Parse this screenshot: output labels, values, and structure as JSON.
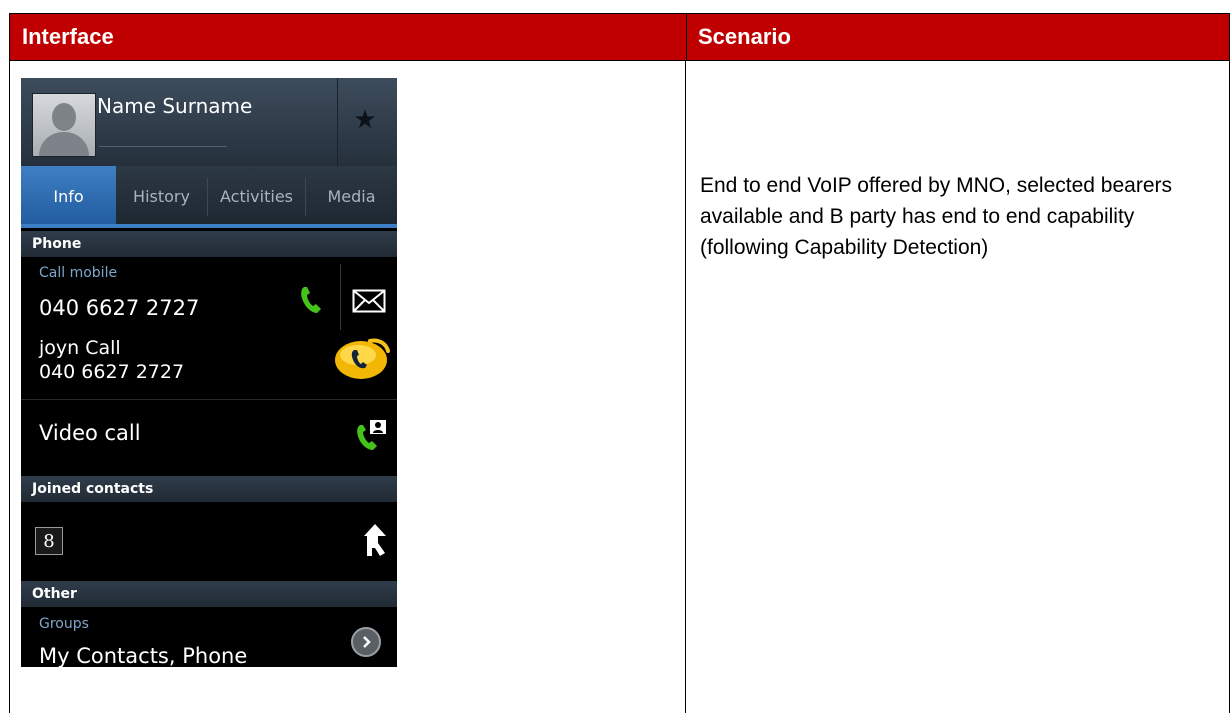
{
  "table": {
    "header_left": "Interface",
    "header_right": "Scenario",
    "scenario_text": "End to end VoIP offered by MNO, selected bearers available and B party has end to end capability (following Capability Detection)"
  },
  "phone": {
    "contact_name": "Name Surname",
    "tabs": [
      {
        "label": "Info",
        "active": true
      },
      {
        "label": "History",
        "active": false
      },
      {
        "label": "Activities",
        "active": false
      },
      {
        "label": "Media",
        "active": false
      }
    ],
    "sections": {
      "phone": "Phone",
      "joined": "Joined contacts",
      "other": "Other"
    },
    "call_mobile_label": "Call mobile",
    "call_mobile_number": "040 6627 2727",
    "joyn_call_label": "joyn Call",
    "joyn_call_number": "040 6627 2727",
    "video_call_label": "Video call",
    "google_badge": "8",
    "groups_label": "Groups",
    "groups_value": "My Contacts, Phone"
  },
  "colors": {
    "header_red": "#c00000",
    "tab_active_blue": "#2f6fb3",
    "call_green": "#44c31a",
    "joyn_yellow": "#f2b705"
  }
}
